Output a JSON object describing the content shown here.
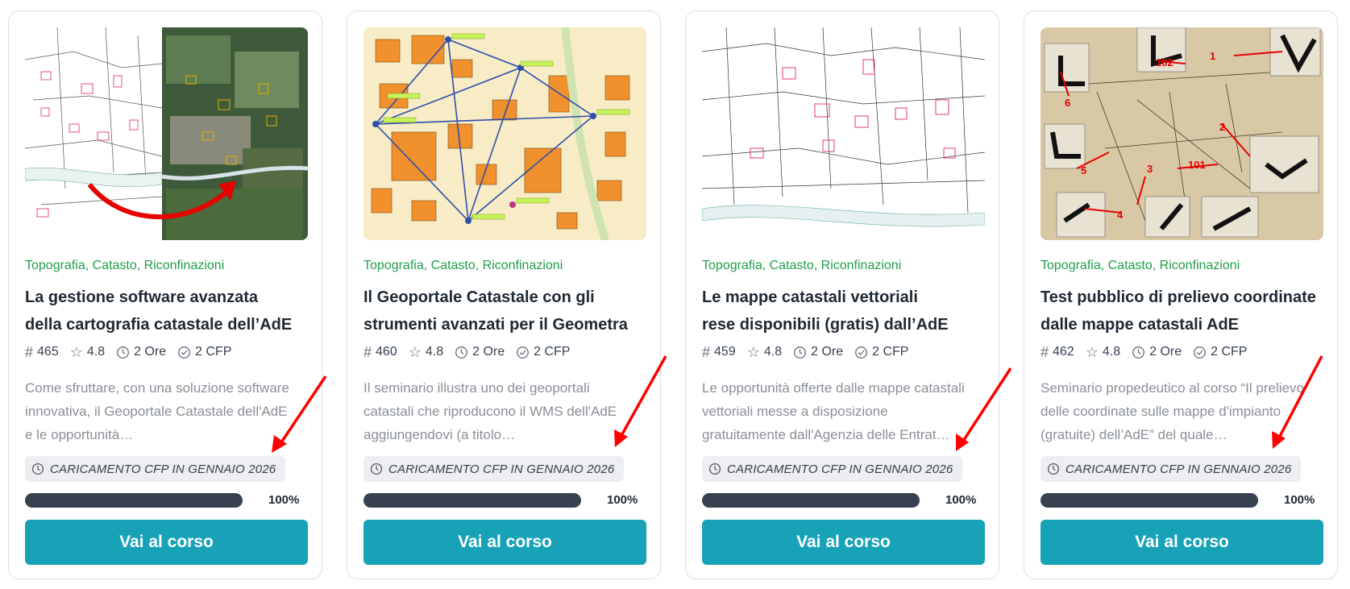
{
  "courses": [
    {
      "categories": "Topografia, Catasto, Riconfinazioni",
      "title_line1": "La gestione software avanzata",
      "title_line2": "della cartografia catastale dell’AdE",
      "id": "465",
      "rating": "4.8",
      "duration": "2 Ore",
      "cfp": "2 CFP",
      "description": "Come sfruttare, con una soluzione software innovativa, il Geoportale Catastale dell'AdE e le opportunità…",
      "badge": "CARICAMENTO CFP IN GENNAIO 2026",
      "progress_percent": 100,
      "progress_label": "100%",
      "button": "Vai al corso"
    },
    {
      "categories": "Topografia, Catasto, Riconfinazioni",
      "title_line1": "Il Geoportale Catastale con gli",
      "title_line2": "strumenti avanzati per il Geometra",
      "id": "460",
      "rating": "4.8",
      "duration": "2 Ore",
      "cfp": "2 CFP",
      "description": "Il seminario illustra uno dei geoportali catastali che riproducono il WMS dell'AdE aggiungendovi (a titolo…",
      "badge": "CARICAMENTO CFP IN GENNAIO 2026",
      "progress_percent": 100,
      "progress_label": "100%",
      "button": "Vai al corso"
    },
    {
      "categories": "Topografia, Catasto, Riconfinazioni",
      "title_line1": "Le mappe catastali vettoriali",
      "title_line2": "rese disponibili (gratis) dall’AdE",
      "id": "459",
      "rating": "4.8",
      "duration": "2 Ore",
      "cfp": "2 CFP",
      "description": "Le opportunità offerte dalle mappe catastali vettoriali messe a disposizione gratuitamente dall'Agenzia delle Entrat…",
      "badge": "CARICAMENTO CFP IN GENNAIO 2026",
      "progress_percent": 100,
      "progress_label": "100%",
      "button": "Vai al corso"
    },
    {
      "categories": "Topografia, Catasto, Riconfinazioni",
      "title_line1": "Test pubblico di prelievo coordinate",
      "title_line2": "dalle mappe catastali AdE",
      "id": "462",
      "rating": "4.8",
      "duration": "2 Ore",
      "cfp": "2 CFP",
      "description": "Seminario propedeutico al corso “Il prelievo delle coordinate sulle mappe d'impianto (gratuite) dell’AdE” del quale…",
      "badge": "CARICAMENTO CFP IN GENNAIO 2026",
      "progress_percent": 100,
      "progress_label": "100%",
      "button": "Vai al corso"
    }
  ],
  "thumbnail_labels": {
    "card4_numbers": [
      "1",
      "102",
      "6",
      "2",
      "5",
      "3",
      "101",
      "4"
    ]
  },
  "colors": {
    "category": "#1e9e4a",
    "button": "#17a2b8",
    "progress": "#384150",
    "annotation_arrow": "#ff0000"
  }
}
